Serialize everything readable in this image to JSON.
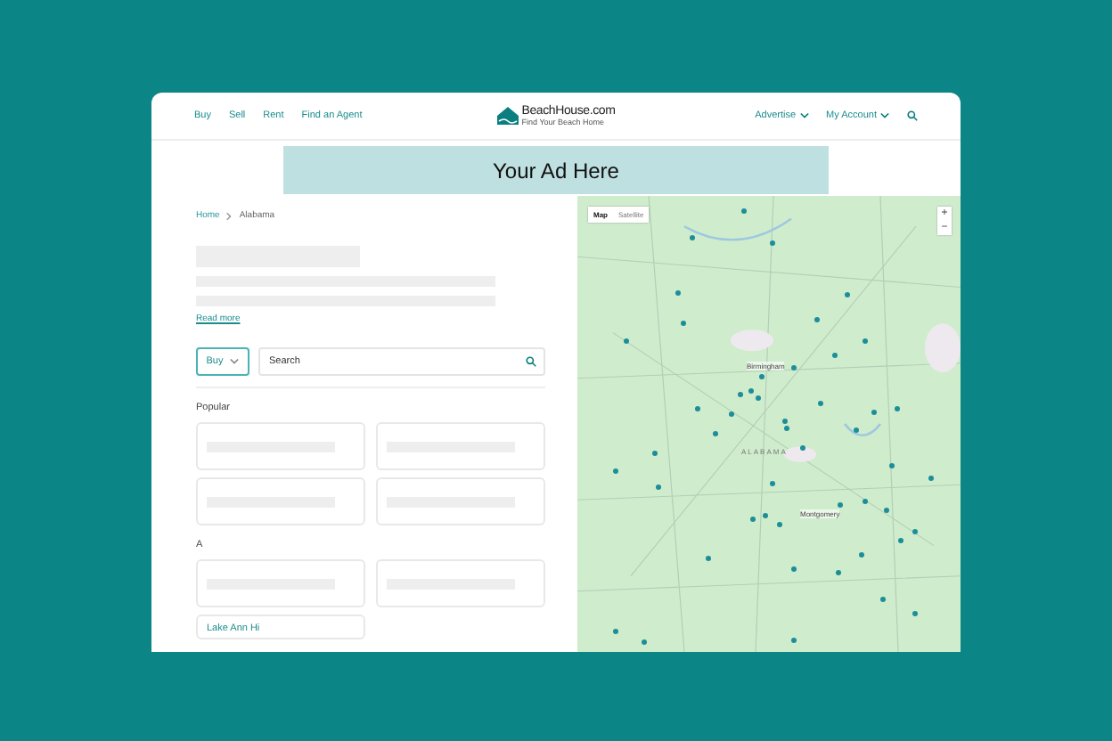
{
  "header": {
    "nav_left": [
      "Buy",
      "Sell",
      "Rent",
      "Find an Agent"
    ],
    "logo": {
      "name": "BeachHouse.com",
      "tagline": "Find Your Beach Home"
    },
    "nav_right": [
      {
        "label": "Advertise"
      },
      {
        "label": "My Account"
      }
    ]
  },
  "ad_banner": {
    "text": "Your Ad Here"
  },
  "breadcrumb": [
    "Home",
    "Alabama"
  ],
  "read_more": "Read more",
  "search": {
    "mode": "Buy",
    "placeholder": "Search"
  },
  "sections": [
    {
      "title": "Popular",
      "cards": [
        {
          "kind": "loading"
        },
        {
          "kind": "loading"
        },
        {
          "kind": "loading"
        },
        {
          "kind": "loading"
        }
      ]
    },
    {
      "title": "A",
      "cards": [
        {
          "kind": "loading"
        },
        {
          "kind": "loading"
        },
        {
          "kind": "link",
          "label": "Lake Ann Hi"
        }
      ]
    }
  ],
  "map": {
    "types": [
      {
        "label": "Map",
        "selected": true
      },
      {
        "label": "Satellite",
        "selected": false
      }
    ],
    "zoom_in": "+",
    "zoom_out": "−",
    "labels": [
      {
        "kind": "city",
        "text": "Birmingham"
      },
      {
        "kind": "state",
        "text": "ALABAMA"
      },
      {
        "kind": "city",
        "text": "Montgomery"
      }
    ]
  }
}
